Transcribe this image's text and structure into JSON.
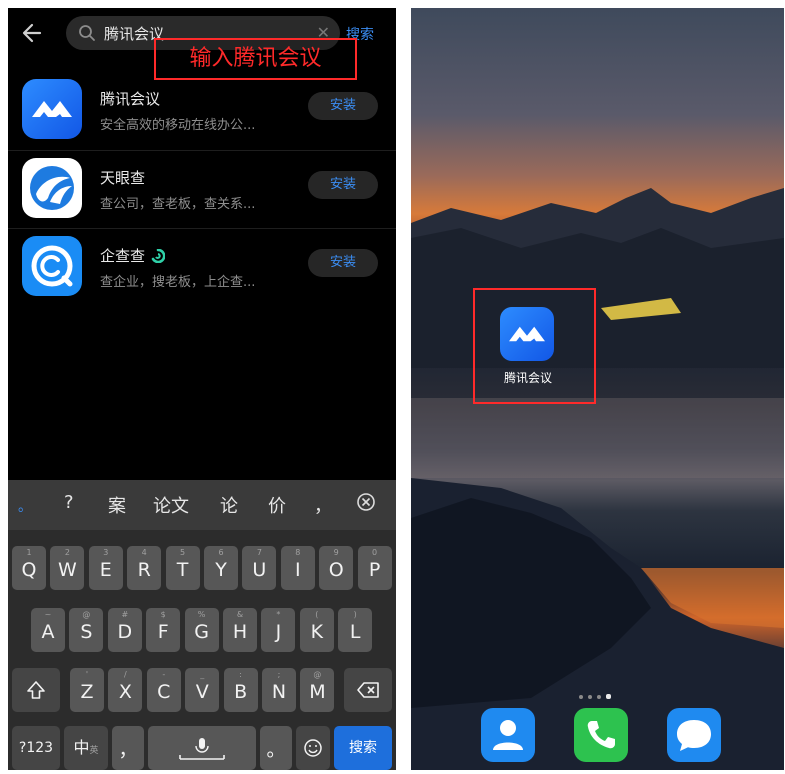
{
  "search": {
    "query": "腾讯会议",
    "action_label": "搜索"
  },
  "annotation": {
    "label": "输入腾讯会议"
  },
  "results": [
    {
      "name": "腾讯会议",
      "desc": "安全高效的移动在线办公...",
      "install": "安装",
      "icon": "tencent-meeting-icon"
    },
    {
      "name": "天眼查",
      "desc": "查公司，查老板，查关系...",
      "install": "安装",
      "icon": "tianyancha-icon"
    },
    {
      "name": "企查查",
      "desc": "查企业，搜老板，上企查...",
      "install": "安装",
      "icon": "qichacha-icon"
    }
  ],
  "keyboard": {
    "candidates": [
      "。",
      "?",
      "案",
      "论文",
      "论",
      "价",
      "，"
    ],
    "row1": [
      {
        "k": "Q",
        "s": "1"
      },
      {
        "k": "W",
        "s": "2"
      },
      {
        "k": "E",
        "s": "3"
      },
      {
        "k": "R",
        "s": "4"
      },
      {
        "k": "T",
        "s": "5"
      },
      {
        "k": "Y",
        "s": "6"
      },
      {
        "k": "U",
        "s": "7"
      },
      {
        "k": "I",
        "s": "8"
      },
      {
        "k": "O",
        "s": "9"
      },
      {
        "k": "P",
        "s": "0"
      }
    ],
    "row2": [
      {
        "k": "A",
        "s": "~"
      },
      {
        "k": "S",
        "s": "@"
      },
      {
        "k": "D",
        "s": "#"
      },
      {
        "k": "F",
        "s": "$"
      },
      {
        "k": "G",
        "s": "%"
      },
      {
        "k": "H",
        "s": "&"
      },
      {
        "k": "J",
        "s": "*"
      },
      {
        "k": "K",
        "s": "("
      },
      {
        "k": "L",
        "s": ")"
      }
    ],
    "row3": [
      {
        "k": "Z",
        "s": "'"
      },
      {
        "k": "X",
        "s": "/"
      },
      {
        "k": "C",
        "s": "-"
      },
      {
        "k": "V",
        "s": "_"
      },
      {
        "k": "B",
        "s": ":"
      },
      {
        "k": "N",
        "s": ";"
      },
      {
        "k": "M",
        "s": "@"
      }
    ],
    "num_label": "?123",
    "lang_label": "中",
    "lang_sub": "英",
    "comma": "，",
    "period": "。",
    "search_label": "搜索"
  },
  "home": {
    "app_label": "腾讯会议"
  },
  "dock": [
    "contacts-icon",
    "phone-icon",
    "messages-icon"
  ]
}
